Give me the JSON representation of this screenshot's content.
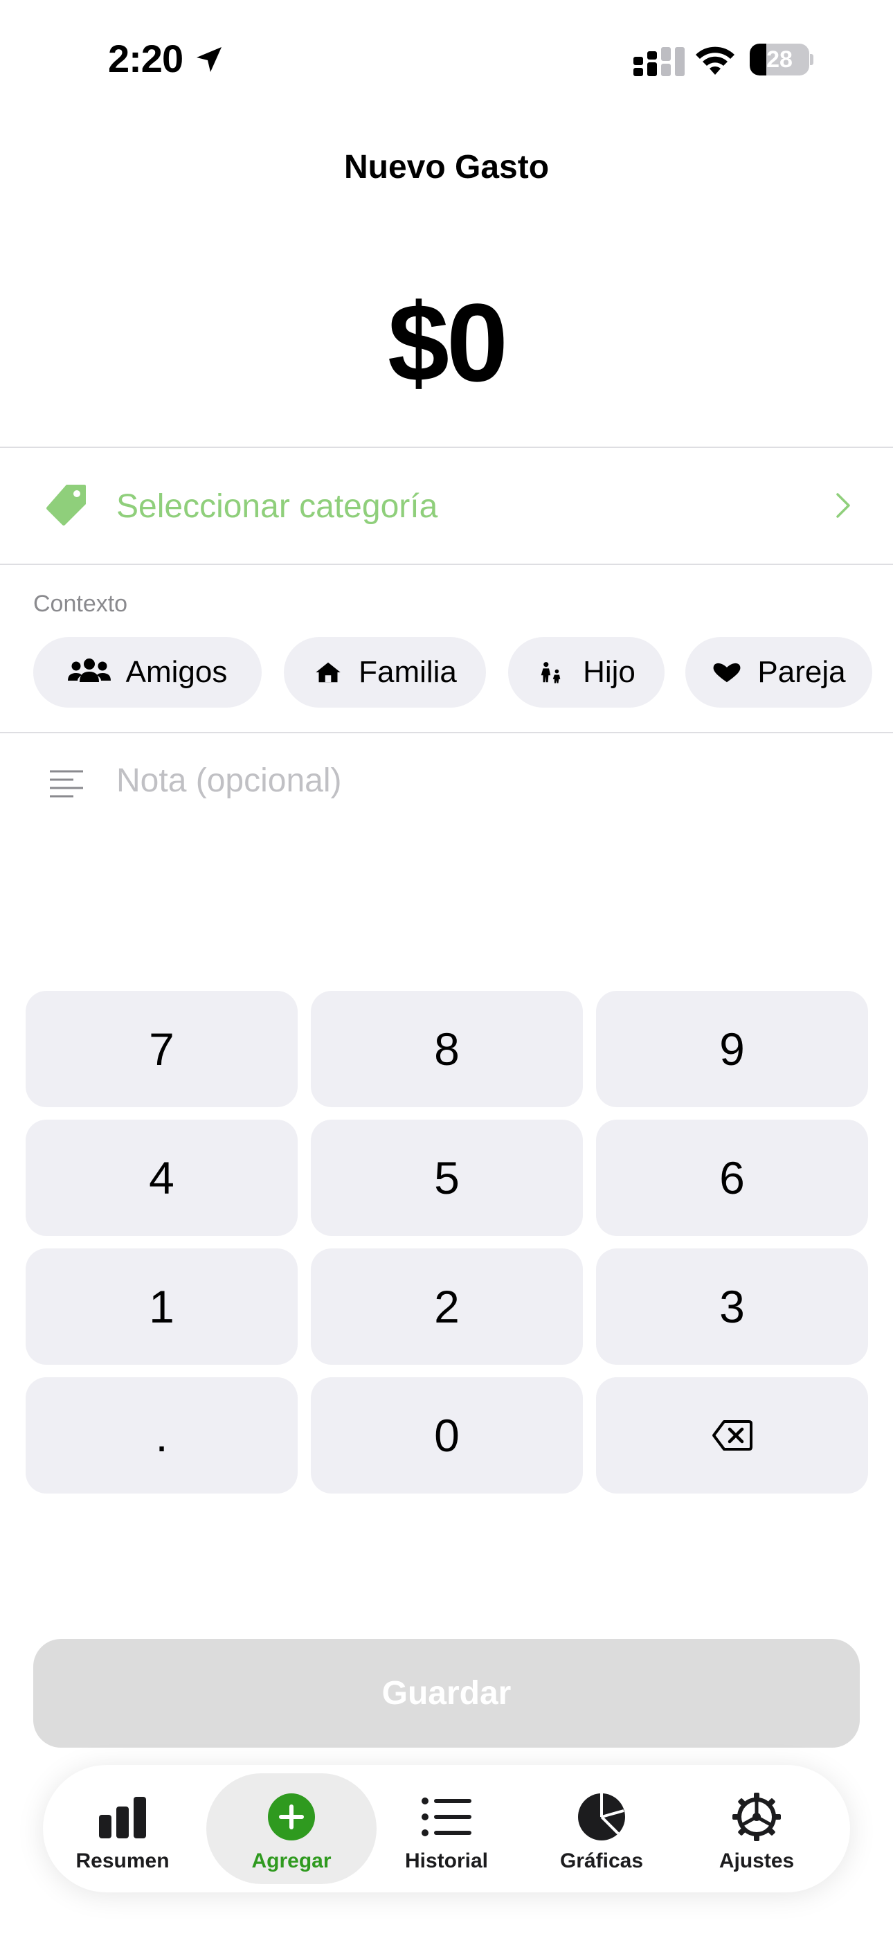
{
  "status_bar": {
    "time": "2:20",
    "battery_level": "28",
    "battery_fraction": 0.28,
    "icons": [
      "location-arrow-icon",
      "signal-icon",
      "wifi-icon",
      "battery-icon"
    ]
  },
  "header": {
    "title": "Nuevo Gasto"
  },
  "amount": {
    "value": "$0"
  },
  "category": {
    "placeholder": "Seleccionar categoría",
    "icon": "tag-icon",
    "accent": "#8fcf7b"
  },
  "context": {
    "label": "Contexto",
    "chips": [
      {
        "label": "Amigos",
        "icon": "people-icon"
      },
      {
        "label": "Familia",
        "icon": "house-icon"
      },
      {
        "label": "Hijo",
        "icon": "parent-child-icon"
      },
      {
        "label": "Pareja",
        "icon": "heart-icon"
      }
    ]
  },
  "note": {
    "placeholder": "Nota (opcional)",
    "value": "",
    "icon": "text-lines-icon"
  },
  "keypad": {
    "keys": [
      "7",
      "8",
      "9",
      "4",
      "5",
      "6",
      "1",
      "2",
      "3",
      ".",
      "0",
      "backspace"
    ]
  },
  "save": {
    "label": "Guardar"
  },
  "tabbar": {
    "active_color": "#2f9a1f",
    "tabs": [
      {
        "label": "Resumen",
        "icon": "bar-chart-icon"
      },
      {
        "label": "Agregar",
        "icon": "plus-circle-icon"
      },
      {
        "label": "Historial",
        "icon": "list-icon"
      },
      {
        "label": "Gráficas",
        "icon": "pie-chart-icon"
      },
      {
        "label": "Ajustes",
        "icon": "gear-icon"
      }
    ]
  }
}
